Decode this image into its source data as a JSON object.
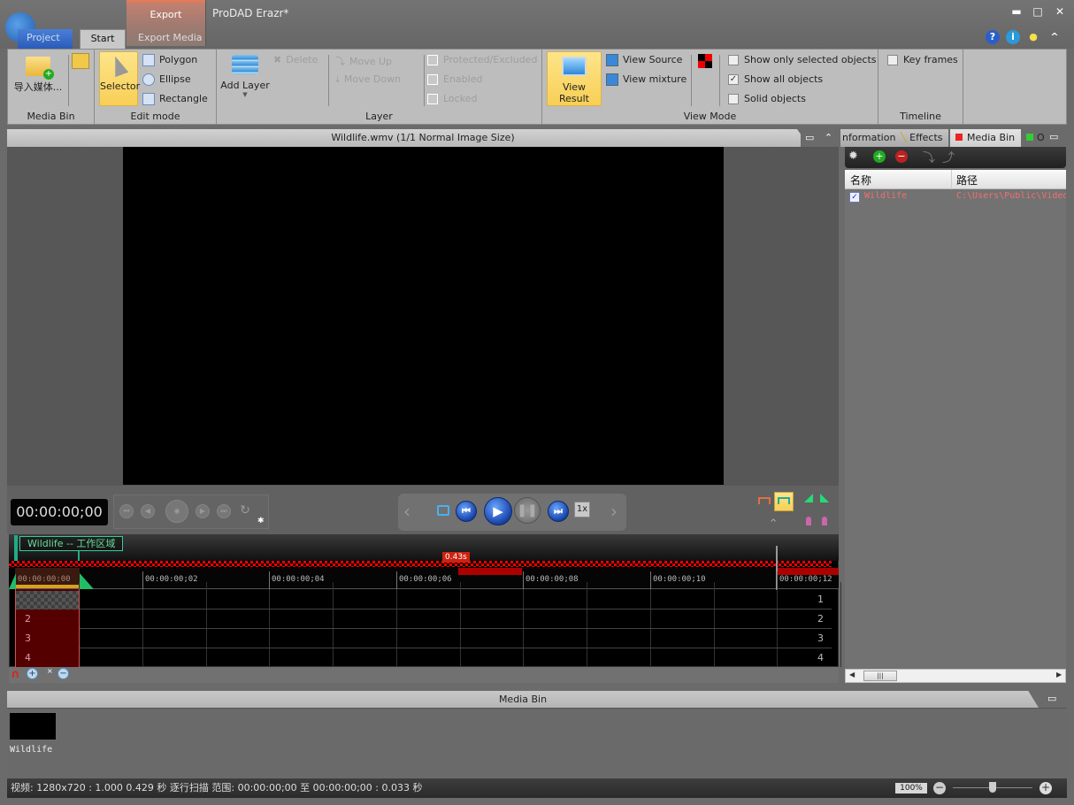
{
  "app": {
    "title": "ProDAD Erazr*",
    "tabs": [
      "Project",
      "Start",
      "Export Media"
    ],
    "active_tab": "Start",
    "export_context_tab": "Export",
    "window_controls": {
      "minimize": "▬",
      "maximize": "□",
      "close": "✕"
    },
    "help_icons": {
      "help": "?",
      "info": "i",
      "tip": "💡",
      "collapse": "^"
    }
  },
  "ribbon": {
    "media_bin": {
      "label": "Media Bin",
      "import_label": "导入媒体..."
    },
    "edit_mode": {
      "label": "Edit mode",
      "selector": "Selector",
      "polygon": "Polygon",
      "ellipse": "Ellipse",
      "rectangle": "Rectangle"
    },
    "layer": {
      "label": "Layer",
      "add_layer": "Add Layer",
      "delete": "Delete",
      "move_up": "Move Up",
      "move_down": "Move Down",
      "protected": "Protected/Excluded",
      "enabled": "Enabled",
      "locked": "Locked"
    },
    "view_mode": {
      "label": "View Mode",
      "view_result": "View Result",
      "view_source": "View Source",
      "view_mixture": "View mixture",
      "show_only_selected": {
        "label": "Show only selected objects",
        "checked": false
      },
      "show_all": {
        "label": "Show all objects",
        "checked": true
      },
      "solid": {
        "label": "Solid objects",
        "checked": false
      }
    },
    "timeline": {
      "label": "Timeline",
      "key_frames": {
        "label": "Key frames",
        "checked": false
      }
    }
  },
  "viewer": {
    "title": "Wildlife.wmv   (1/1  Normal Image Size)",
    "timecode": "00:00:00;00",
    "speed": "1x"
  },
  "timeline": {
    "workarea_label": "Wildlife -- 工作区域",
    "duration_badge": "0.43s",
    "ticks": [
      "00:00:00;00",
      "00:00:00;02",
      "00:00:00;04",
      "00:00:00;06",
      "00:00:00;08",
      "00:00:00;10",
      "00:00:00;12"
    ],
    "tracks_left": [
      "",
      "2",
      "3",
      "4"
    ],
    "tracks_right": [
      "1",
      "2",
      "3",
      "4"
    ]
  },
  "right_panel": {
    "tabs": [
      "nformation",
      "Effects",
      "Media Bin",
      "O"
    ],
    "active_tab": "Media Bin",
    "columns": [
      "名称",
      "路径"
    ],
    "rows": [
      {
        "checked": true,
        "name": "Wildlife",
        "path": "C:\\Users\\Public\\Videos"
      }
    ]
  },
  "media_bin": {
    "title": "Media Bin",
    "items": [
      {
        "name": "Wildlife"
      }
    ]
  },
  "status": {
    "text": "视频: 1280x720 : 1.000   0.429 秒   逐行扫描   范围: 00:00:00;00 至 00:00:00;00 : 0.033 秒",
    "zoom": "100%",
    "zoom_slider_fraction": 0.5
  },
  "colors": {
    "accent_active": "#f8cf55",
    "record_red": "#e00000",
    "workarea_green": "#33cc99"
  }
}
